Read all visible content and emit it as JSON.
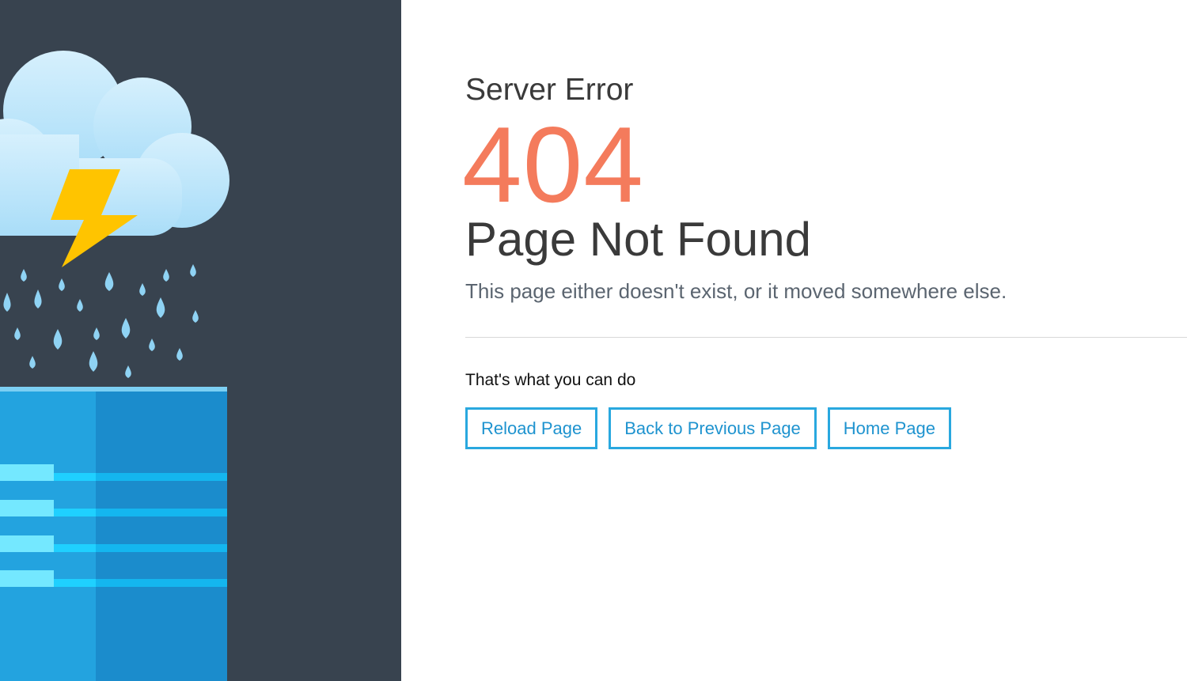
{
  "error": {
    "kind": "Server Error",
    "code": "404",
    "title": "Page Not Found",
    "description": "This page either doesn't exist, or it moved somewhere else."
  },
  "actions": {
    "heading": "That's what you can do",
    "reload_label": "Reload Page",
    "back_label": "Back to Previous Page",
    "home_label": "Home Page"
  },
  "colors": {
    "panel": "#38434f",
    "accent_code": "#f47b5c",
    "button_border": "#29a8df",
    "cloud": "#c8eafc",
    "lightning": "#ffc200",
    "raindrop": "#8fd3f4",
    "server": "#1e9ad8"
  },
  "icons": {
    "illustration": [
      "cloud-icon",
      "lightning-icon",
      "raindrop-icon",
      "server-icon"
    ]
  }
}
